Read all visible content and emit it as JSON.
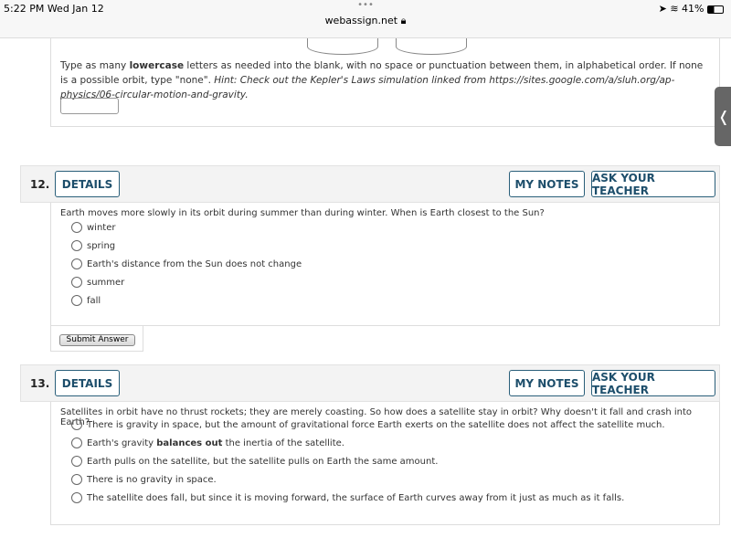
{
  "status": {
    "time": "5:22 PM  Wed Jan 12",
    "url": "webassign.net",
    "battery": "41%",
    "dots": "•••"
  },
  "prev": {
    "text_pre": "Type as many ",
    "bold": "lowercase",
    "text_post": " letters as needed into the blank, with no space or punctuation between them, in alphabetical order. If none is a possible orbit, type \"none\". ",
    "hint": "Hint: Check out the Kepler's Laws simulation linked from https://sites.google.com/a/sluh.org/ap-physics/06-circular-motion-and-gravity."
  },
  "q12": {
    "number": "12.",
    "details": "DETAILS",
    "notes": "MY NOTES",
    "ask": "ASK YOUR TEACHER",
    "question": "Earth moves more slowly in its orbit during summer than during winter. When is Earth closest to the Sun?",
    "options": [
      "winter",
      "spring",
      "Earth's distance from the Sun does not change",
      "summer",
      "fall"
    ],
    "submit": "Submit Answer"
  },
  "q13": {
    "number": "13.",
    "details": "DETAILS",
    "notes": "MY NOTES",
    "ask": "ASK YOUR TEACHER",
    "question": "Satellites in orbit have no thrust rockets; they are merely coasting. So how does a satellite stay in orbit? Why doesn't it fall and crash into Earth?",
    "options": [
      "There is gravity in space, but the amount of gravitational force Earth exerts on the satellite does not affect the satellite much.",
      "Earth's gravity ",
      "Earth pulls on the satellite, but the satellite pulls on Earth the same amount.",
      "There is no gravity in space.",
      "The satellite does fall, but since it is moving forward, the surface of Earth curves away from it just as much as it falls."
    ],
    "opt2_bold": "balances out",
    "opt2_post": " the inertia of the satellite."
  },
  "sidetab": {
    "icon": "chevron-left-icon",
    "glyph": "❬"
  }
}
